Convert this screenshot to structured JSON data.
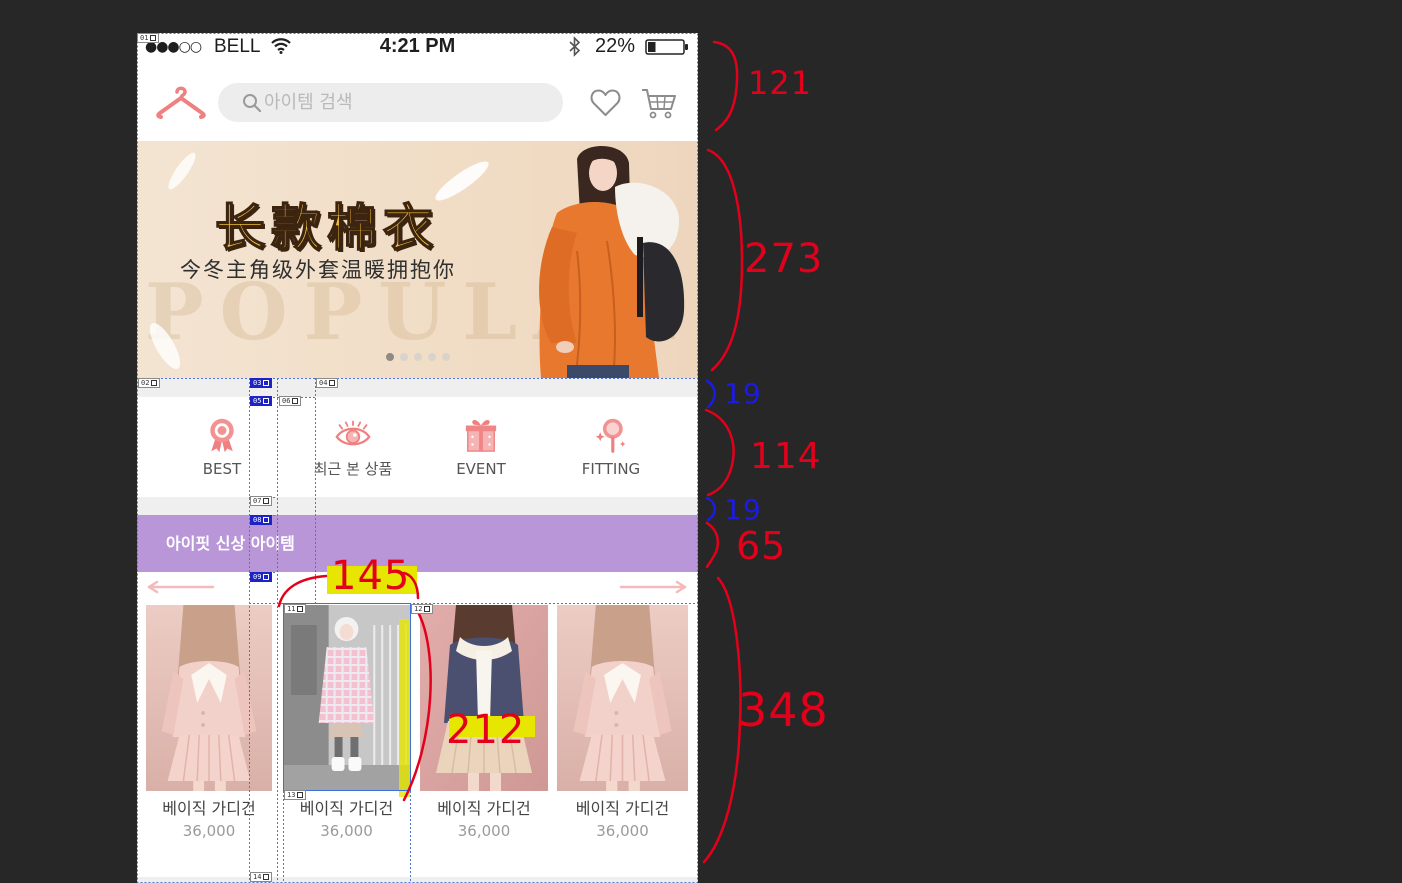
{
  "status_bar": {
    "signal": "●●●○○",
    "carrier": "BELL",
    "time": "4:21 PM",
    "battery_percent": "22%",
    "battery_level": 0.22,
    "icons": [
      "wifi-icon",
      "bluetooth-icon",
      "battery-icon"
    ]
  },
  "header": {
    "logo_icon": "hanger-icon",
    "search_icon": "search-icon",
    "search_placeholder": "아이템 검색",
    "wishlist_icon": "heart-icon",
    "cart_icon": "cart-icon",
    "accent_color": "#f07f80"
  },
  "banner": {
    "title": "长款棉衣",
    "subtitle": "今冬主角级外套温暖拥抱你",
    "watermark": "POPULAR",
    "slide_count": 5,
    "active_slide": 1
  },
  "categories": [
    {
      "label": "BEST",
      "icon": "medal-icon"
    },
    {
      "label": "최근 본 상품",
      "icon": "eye-icon"
    },
    {
      "label": "EVENT",
      "icon": "gift-icon"
    },
    {
      "label": "FITTING",
      "icon": "magic-mirror-icon"
    }
  ],
  "new_items": {
    "title": "아이핏 신상 아이템",
    "background_color": "#b996d8",
    "prev_icon": "arrow-left-icon",
    "next_icon": "arrow-right-icon"
  },
  "products": [
    {
      "name": "베이직 가디건",
      "price": "36,000"
    },
    {
      "name": "베이직 가디건",
      "price": "36,000"
    },
    {
      "name": "베이직 가디건",
      "price": "36,000"
    },
    {
      "name": "베이직 가디건",
      "price": "36,000"
    }
  ],
  "slice_markers": [
    "01",
    "02",
    "03",
    "04",
    "05",
    "06",
    "07",
    "08",
    "09",
    "11",
    "12",
    "13",
    "14"
  ],
  "annotations": {
    "notes": [
      "121",
      "273",
      "19",
      "114",
      "19",
      "65",
      "348",
      "145",
      "212"
    ],
    "pen_color": "#e3001b",
    "blue_pen_color": "#1b1be5",
    "highlight_color": "#e6e600"
  }
}
